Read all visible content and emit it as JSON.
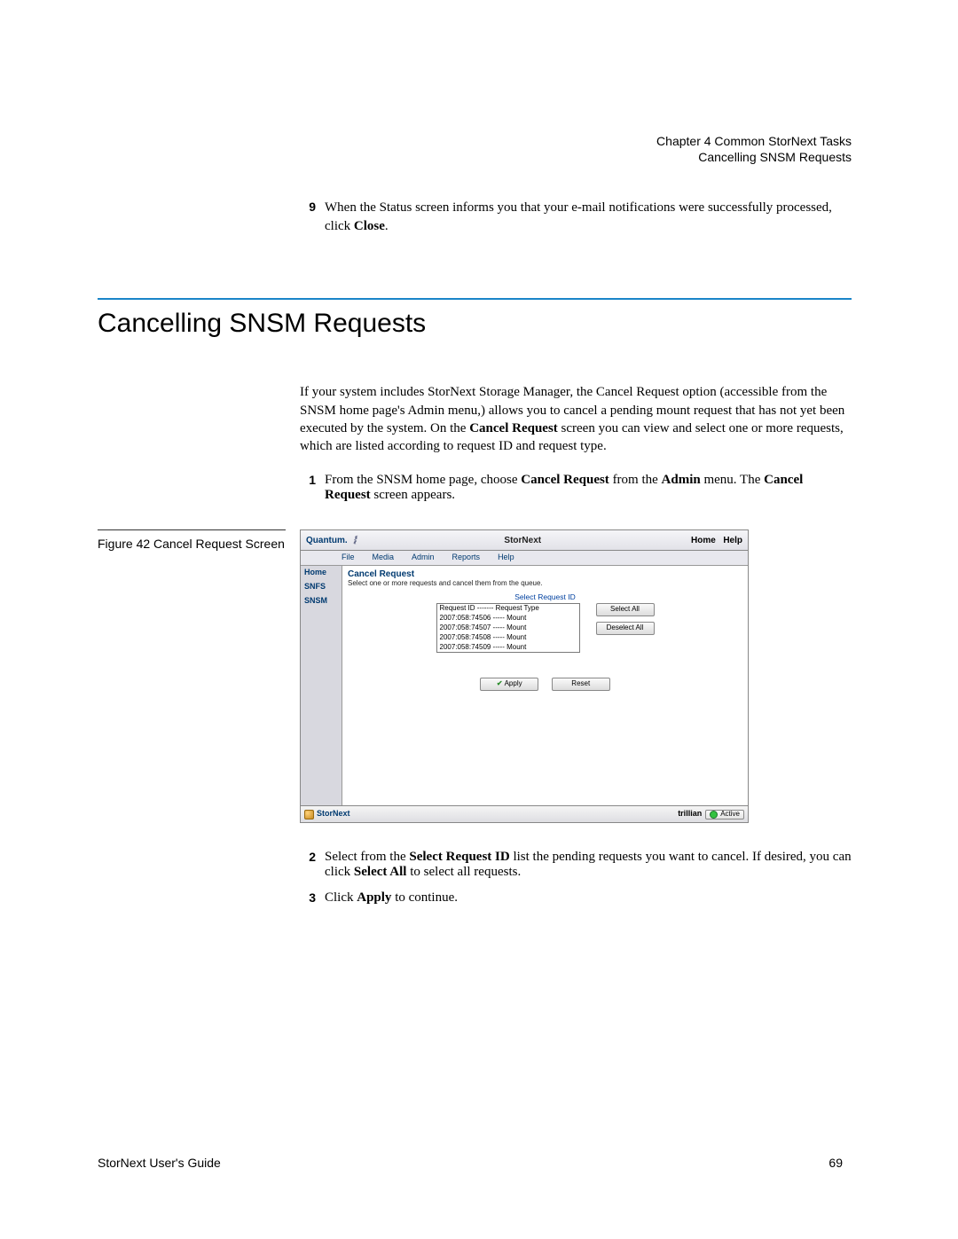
{
  "header": {
    "chapter": "Chapter 4  Common StorNext Tasks",
    "section": "Cancelling SNSM Requests"
  },
  "step9": {
    "num": "9",
    "text_a": "When the Status screen informs you that your e-mail notifications were successfully processed, click ",
    "bold": "Close",
    "text_b": "."
  },
  "section_title": "Cancelling SNSM Requests",
  "intro": {
    "p1_a": "If your system includes StorNext Storage Manager, the Cancel Request option (accessible from the SNSM home page's Admin menu,) allows you to cancel a pending mount request that has not yet been executed by the system. On the ",
    "p1_b": "Cancel Request",
    "p1_c": " screen you can view and select one or more requests, which are listed according to request ID and request type."
  },
  "step1": {
    "num": "1",
    "t1": "From the SNSM home page, choose ",
    "b1": "Cancel Request",
    "t2": " from the ",
    "b2": "Admin",
    "t3": " menu. The ",
    "b3": "Cancel Request",
    "t4": " screen appears."
  },
  "figure_caption": "Figure 42  Cancel Request Screen",
  "app": {
    "brand": "Quantum.",
    "swoosh": "◤―◥",
    "title": "StorNext",
    "nav_home": "Home",
    "nav_help": "Help",
    "menus": [
      "File",
      "Media",
      "Admin",
      "Reports",
      "Help"
    ],
    "sidebar": [
      "Home",
      "SNFS",
      "SNSM"
    ],
    "panel_title": "Cancel Request",
    "panel_desc": "Select one or more requests and cancel them from the queue.",
    "list_label": "Select Request ID",
    "list_header": "Request ID ------- Request Type",
    "list_items": [
      "2007:058:74506 ----- Mount",
      "2007:058:74507 ----- Mount",
      "2007:058:74508 ----- Mount",
      "2007:058:74509 ----- Mount"
    ],
    "btn_select_all": "Select All",
    "btn_deselect_all": "Deselect All",
    "btn_apply": "Apply",
    "btn_reset": "Reset",
    "footer_product": "StorNext",
    "footer_host": "trillian",
    "footer_status": "Active"
  },
  "step2": {
    "num": "2",
    "t1": "Select from the ",
    "b1": "Select Request ID",
    "t2": " list the pending requests you want to cancel. If desired, you can click ",
    "b2": "Select All",
    "t3": " to select all requests."
  },
  "step3": {
    "num": "3",
    "t1": "Click ",
    "b1": "Apply",
    "t2": " to continue."
  },
  "footer": {
    "guide": "StorNext User's Guide",
    "page": "69"
  }
}
